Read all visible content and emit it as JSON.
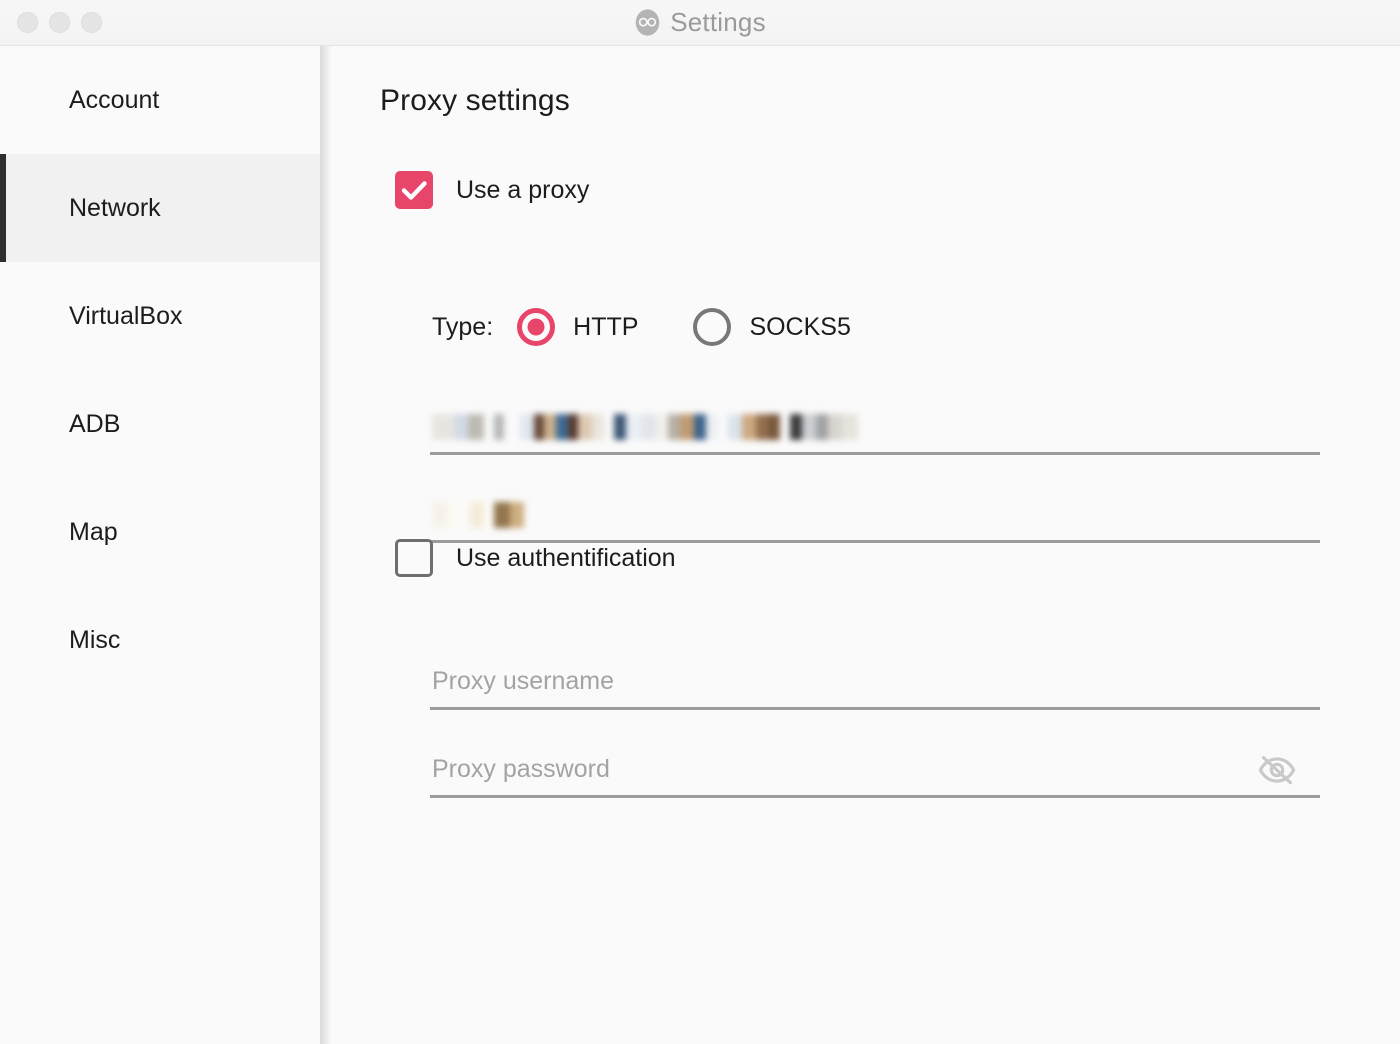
{
  "window": {
    "title": "Settings",
    "logo_icon": "genymotion-logo-icon",
    "traffic_lights": [
      "close-button",
      "minimize-button",
      "zoom-button"
    ]
  },
  "sidebar": {
    "items": [
      {
        "label": "Account",
        "selected": false
      },
      {
        "label": "Network",
        "selected": true
      },
      {
        "label": "VirtualBox",
        "selected": false
      },
      {
        "label": "ADB",
        "selected": false
      },
      {
        "label": "Map",
        "selected": false
      },
      {
        "label": "Misc",
        "selected": false
      }
    ]
  },
  "main": {
    "title": "Proxy settings",
    "use_proxy": {
      "label": "Use a proxy",
      "checked": true
    },
    "type": {
      "label": "Type:",
      "options": [
        {
          "label": "HTTP",
          "selected": true
        },
        {
          "label": "SOCKS5",
          "selected": false
        }
      ]
    },
    "host_field": {
      "name": "proxy-address",
      "value": "",
      "placeholder": "",
      "redacted": true
    },
    "port_field": {
      "name": "proxy-port",
      "value": "",
      "placeholder": "",
      "redacted": true
    },
    "use_authentication": {
      "label": "Use authentification",
      "checked": false
    },
    "username_field": {
      "value": "",
      "placeholder": "Proxy username"
    },
    "password_field": {
      "value": "",
      "placeholder": "Proxy password",
      "reveal_icon": "eye-off-icon"
    }
  },
  "colors": {
    "accent": "#e8456a",
    "text": "#1c1c1c",
    "placeholder": "#a3a3a3",
    "field_underline": "#9c9c9c",
    "sidebar_selected_bg": "#f1f1f1",
    "sidebar_selected_bar": "#2f2f2f",
    "background": "#fafafa",
    "titlebar": "#f4f4f4"
  }
}
